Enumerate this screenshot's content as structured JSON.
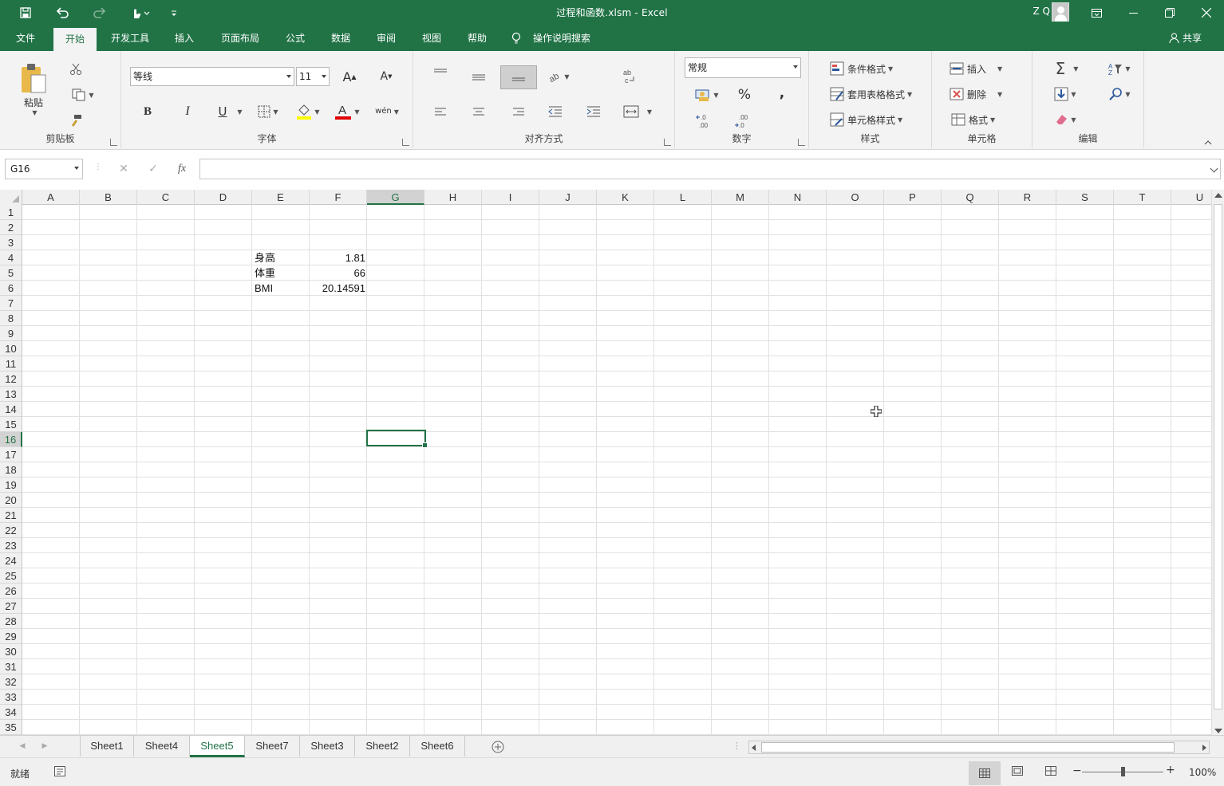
{
  "window": {
    "title": "过程和函数.xlsm  -  Excel",
    "user": "Z Q",
    "qat": {
      "save": "save-icon",
      "undo": "undo-icon",
      "redo": "redo-icon",
      "touch": "touch-mode-icon",
      "customize": "customize-icon"
    },
    "controls": {
      "ribbon_display": "ribbon-display-icon",
      "minimize": "minimize-icon",
      "restore": "restore-icon",
      "close": "close-icon"
    }
  },
  "tabs": [
    "文件",
    "开始",
    "开发工具",
    "插入",
    "页面布局",
    "公式",
    "数据",
    "审阅",
    "视图",
    "帮助"
  ],
  "active_tab": "开始",
  "tell_me": "操作说明搜索",
  "share": "共享",
  "ribbon": {
    "clipboard": {
      "label": "剪贴板",
      "paste": "粘贴"
    },
    "font": {
      "label": "字体",
      "font_name": "等线",
      "font_size": "11",
      "bold": "B",
      "italic": "I",
      "underline": "U",
      "phonetic": "wén"
    },
    "alignment": {
      "label": "对齐方式"
    },
    "number": {
      "label": "数字",
      "format": "常规",
      "percent": "%",
      "comma": ",",
      "inc_decimal": "←.0\n.00",
      "dec_decimal": ".00\n→.0"
    },
    "styles": {
      "label": "样式",
      "conditional": "条件格式",
      "table": "套用表格格式",
      "cell_styles": "单元格样式"
    },
    "cells": {
      "label": "单元格",
      "insert": "插入",
      "delete": "删除",
      "format": "格式"
    },
    "editing": {
      "label": "编辑"
    }
  },
  "formula_bar": {
    "name_box": "G16",
    "fx": "fx",
    "value": ""
  },
  "columns": [
    "A",
    "B",
    "C",
    "D",
    "E",
    "F",
    "G",
    "H",
    "I",
    "J",
    "K",
    "L",
    "M",
    "N",
    "O",
    "P",
    "Q",
    "R",
    "S",
    "T",
    "U"
  ],
  "selected_column": "G",
  "rows": [
    "1",
    "2",
    "3",
    "4",
    "5",
    "6",
    "7",
    "8",
    "9",
    "10",
    "11",
    "12",
    "13",
    "14",
    "15",
    "16",
    "17",
    "18",
    "19",
    "20",
    "21",
    "22",
    "23",
    "24",
    "25",
    "26",
    "27",
    "28",
    "29",
    "30",
    "31",
    "32",
    "33",
    "34",
    "35"
  ],
  "selected_row": "16",
  "cells": {
    "E4": "身高",
    "F4": "1.81",
    "E5": "体重",
    "F5": "66",
    "E6": "BMI",
    "F6": "20.14591"
  },
  "sheets": [
    "Sheet1",
    "Sheet4",
    "Sheet5",
    "Sheet7",
    "Sheet3",
    "Sheet2",
    "Sheet6"
  ],
  "active_sheet": "Sheet5",
  "status": {
    "ready": "就绪",
    "zoom": "100%"
  }
}
